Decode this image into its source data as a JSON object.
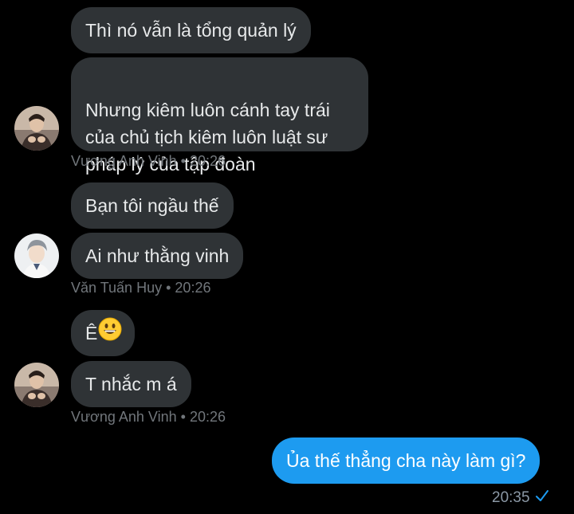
{
  "groups": [
    {
      "sender": "Vương Anh Vinh",
      "time": "20:26",
      "messages": [
        "Thì nó vẫn là tổng quản lý",
        "Nhưng kiêm luôn cánh tay trái\ncủa chủ tịch kiêm luôn luật sư\npháp lý của tập đoàn"
      ]
    },
    {
      "sender": "Văn Tuấn Huy",
      "time": "20:26",
      "messages": [
        "Bạn tôi ngầu thế",
        "Ai như thằng vinh"
      ]
    },
    {
      "sender": "Vương Anh Vinh",
      "time": "20:26",
      "messages": [
        "Ê",
        "T nhắc m á"
      ]
    }
  ],
  "outgoing": {
    "text": "Ủa thế thẳng cha này làm gì?",
    "time": "20:35"
  },
  "separator": "•",
  "icons": {
    "sent_check": "check-icon",
    "emoji": "grinning-face-emoji"
  },
  "colors": {
    "incoming_bubble": "#2f3336",
    "outgoing_bubble": "#1d9bf0",
    "check": "#1d9bf0"
  }
}
